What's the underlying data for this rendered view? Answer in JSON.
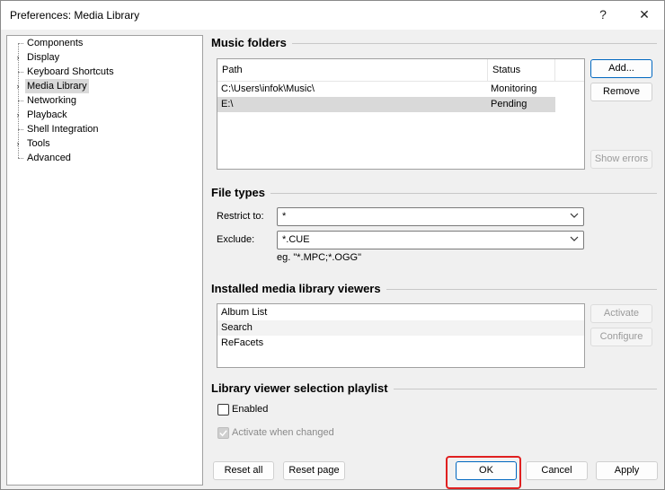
{
  "window": {
    "title": "Preferences: Media Library",
    "help_glyph": "?",
    "close_glyph": "✕"
  },
  "tree": {
    "items": [
      {
        "label": "Components",
        "expander": "",
        "selected": false
      },
      {
        "label": "Display",
        "expander": "›",
        "selected": false
      },
      {
        "label": "Keyboard Shortcuts",
        "expander": "",
        "selected": false
      },
      {
        "label": "Media Library",
        "expander": "›",
        "selected": true
      },
      {
        "label": "Networking",
        "expander": "",
        "selected": false
      },
      {
        "label": "Playback",
        "expander": "›",
        "selected": false
      },
      {
        "label": "Shell Integration",
        "expander": "",
        "selected": false
      },
      {
        "label": "Tools",
        "expander": "›",
        "selected": false
      },
      {
        "label": "Advanced",
        "expander": "",
        "selected": false
      }
    ]
  },
  "music_folders": {
    "title": "Music folders",
    "columns": [
      "Path",
      "Status"
    ],
    "rows": [
      {
        "path": "C:\\Users\\infok\\Music\\",
        "status": "Monitoring",
        "selected": false
      },
      {
        "path": "E:\\",
        "status": "Pending",
        "selected": true
      }
    ],
    "add_label": "Add...",
    "remove_label": "Remove",
    "show_errors_label": "Show errors"
  },
  "file_types": {
    "title": "File types",
    "restrict_label": "Restrict to:",
    "restrict_value": "*",
    "exclude_label": "Exclude:",
    "exclude_value": "*.CUE",
    "hint": "eg. \"*.MPC;*.OGG\""
  },
  "viewers": {
    "title": "Installed media library viewers",
    "items": [
      "Album List",
      "Search",
      "ReFacets"
    ],
    "activate_label": "Activate",
    "configure_label": "Configure"
  },
  "playlist": {
    "title": "Library viewer selection playlist",
    "enabled_label": "Enabled",
    "enabled_checked": false,
    "activate_changed_label": "Activate when changed",
    "activate_changed_checked": true
  },
  "footer": {
    "reset_all_label": "Reset all",
    "reset_page_label": "Reset page",
    "ok_label": "OK",
    "cancel_label": "Cancel",
    "apply_label": "Apply"
  },
  "colors": {
    "accent": "#0067c0",
    "highlight": "#e02020",
    "selection": "#d9d9d9"
  },
  "icons": {
    "dropdown": "chevron-down-icon",
    "check": "checkmark-icon",
    "expander": "chevron-right-icon"
  }
}
